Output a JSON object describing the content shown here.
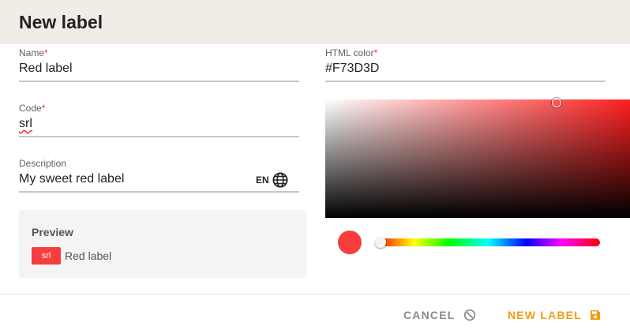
{
  "dialog": {
    "title": "New label"
  },
  "form": {
    "name": {
      "label": "Name",
      "required_mark": "*",
      "value": "Red label"
    },
    "code": {
      "label": "Code",
      "required_mark": "*",
      "value": "srl"
    },
    "description": {
      "label": "Description",
      "value": "My sweet red label",
      "language": "EN",
      "language_icon": "globe-icon"
    }
  },
  "color": {
    "label": "HTML color",
    "required_mark": "*",
    "value": "#F73D3D",
    "selected_hex": "#f73d3d",
    "hue_base_hex": "#ff2020"
  },
  "preview": {
    "title": "Preview",
    "chip_text": "srl",
    "label_text": "Red label"
  },
  "actions": {
    "cancel": {
      "label": "CANCEL",
      "icon": "cancel-icon"
    },
    "submit": {
      "label": "NEW LABEL",
      "icon": "save-icon"
    }
  },
  "colors": {
    "accent": "#f39c12",
    "header_bg": "#f0ece6",
    "required": "#e53935"
  }
}
